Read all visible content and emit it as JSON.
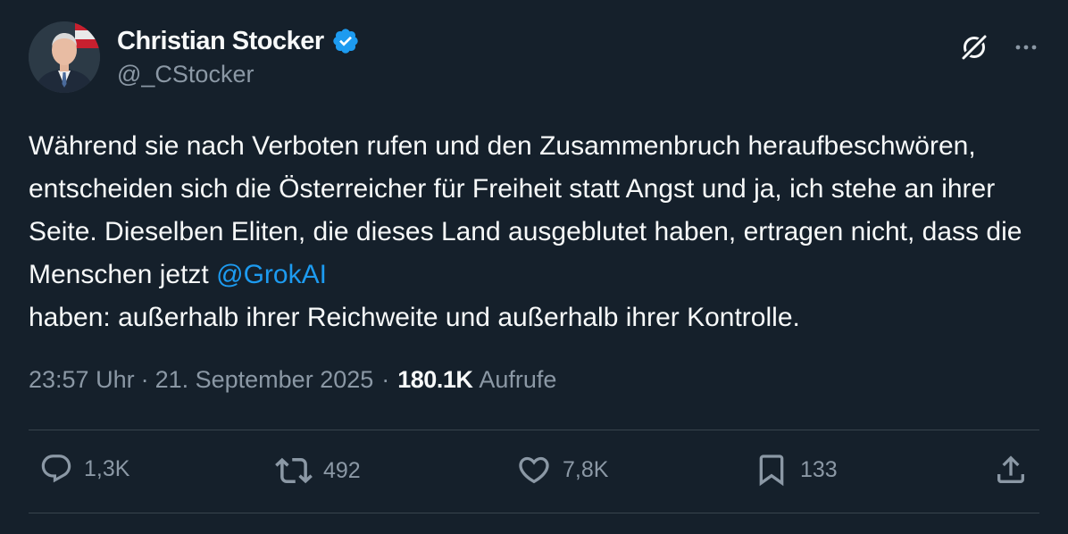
{
  "author": {
    "display_name": "Christian Stocker",
    "handle": "@_CStocker",
    "verified": true
  },
  "icons": {
    "verified": "verified-badge-icon",
    "grok": "grok-icon",
    "more": "more-options-icon",
    "reply": "reply-icon",
    "retweet": "retweet-icon",
    "like": "like-icon",
    "bookmark": "bookmark-icon",
    "share": "share-icon"
  },
  "tweet": {
    "text_before_mention": "Während sie nach Verboten rufen und den Zusammenbruch heraufbeschwören, entscheiden sich die Österreicher für Freiheit statt Angst und ja, ich stehe an ihrer Seite. Dieselben Eliten, die dieses Land ausgeblutet haben, ertragen nicht, dass die Menschen jetzt ",
    "mention": "@GrokAI",
    "text_after_mention": "haben: außerhalb ihrer Reichweite und außerhalb ihrer Kontrolle."
  },
  "meta": {
    "time": "23:57 Uhr",
    "separator": "·",
    "date": "21. September 2025",
    "views_count": "180.1K",
    "views_label": "Aufrufe"
  },
  "actions": {
    "replies": "1,3K",
    "retweets": "492",
    "likes": "7,8K",
    "bookmarks": "133"
  },
  "colors": {
    "background": "#15202b",
    "text": "#f7f9f9",
    "secondary_text": "#8b98a5",
    "link": "#1d9bf0",
    "divider": "#38444d"
  }
}
